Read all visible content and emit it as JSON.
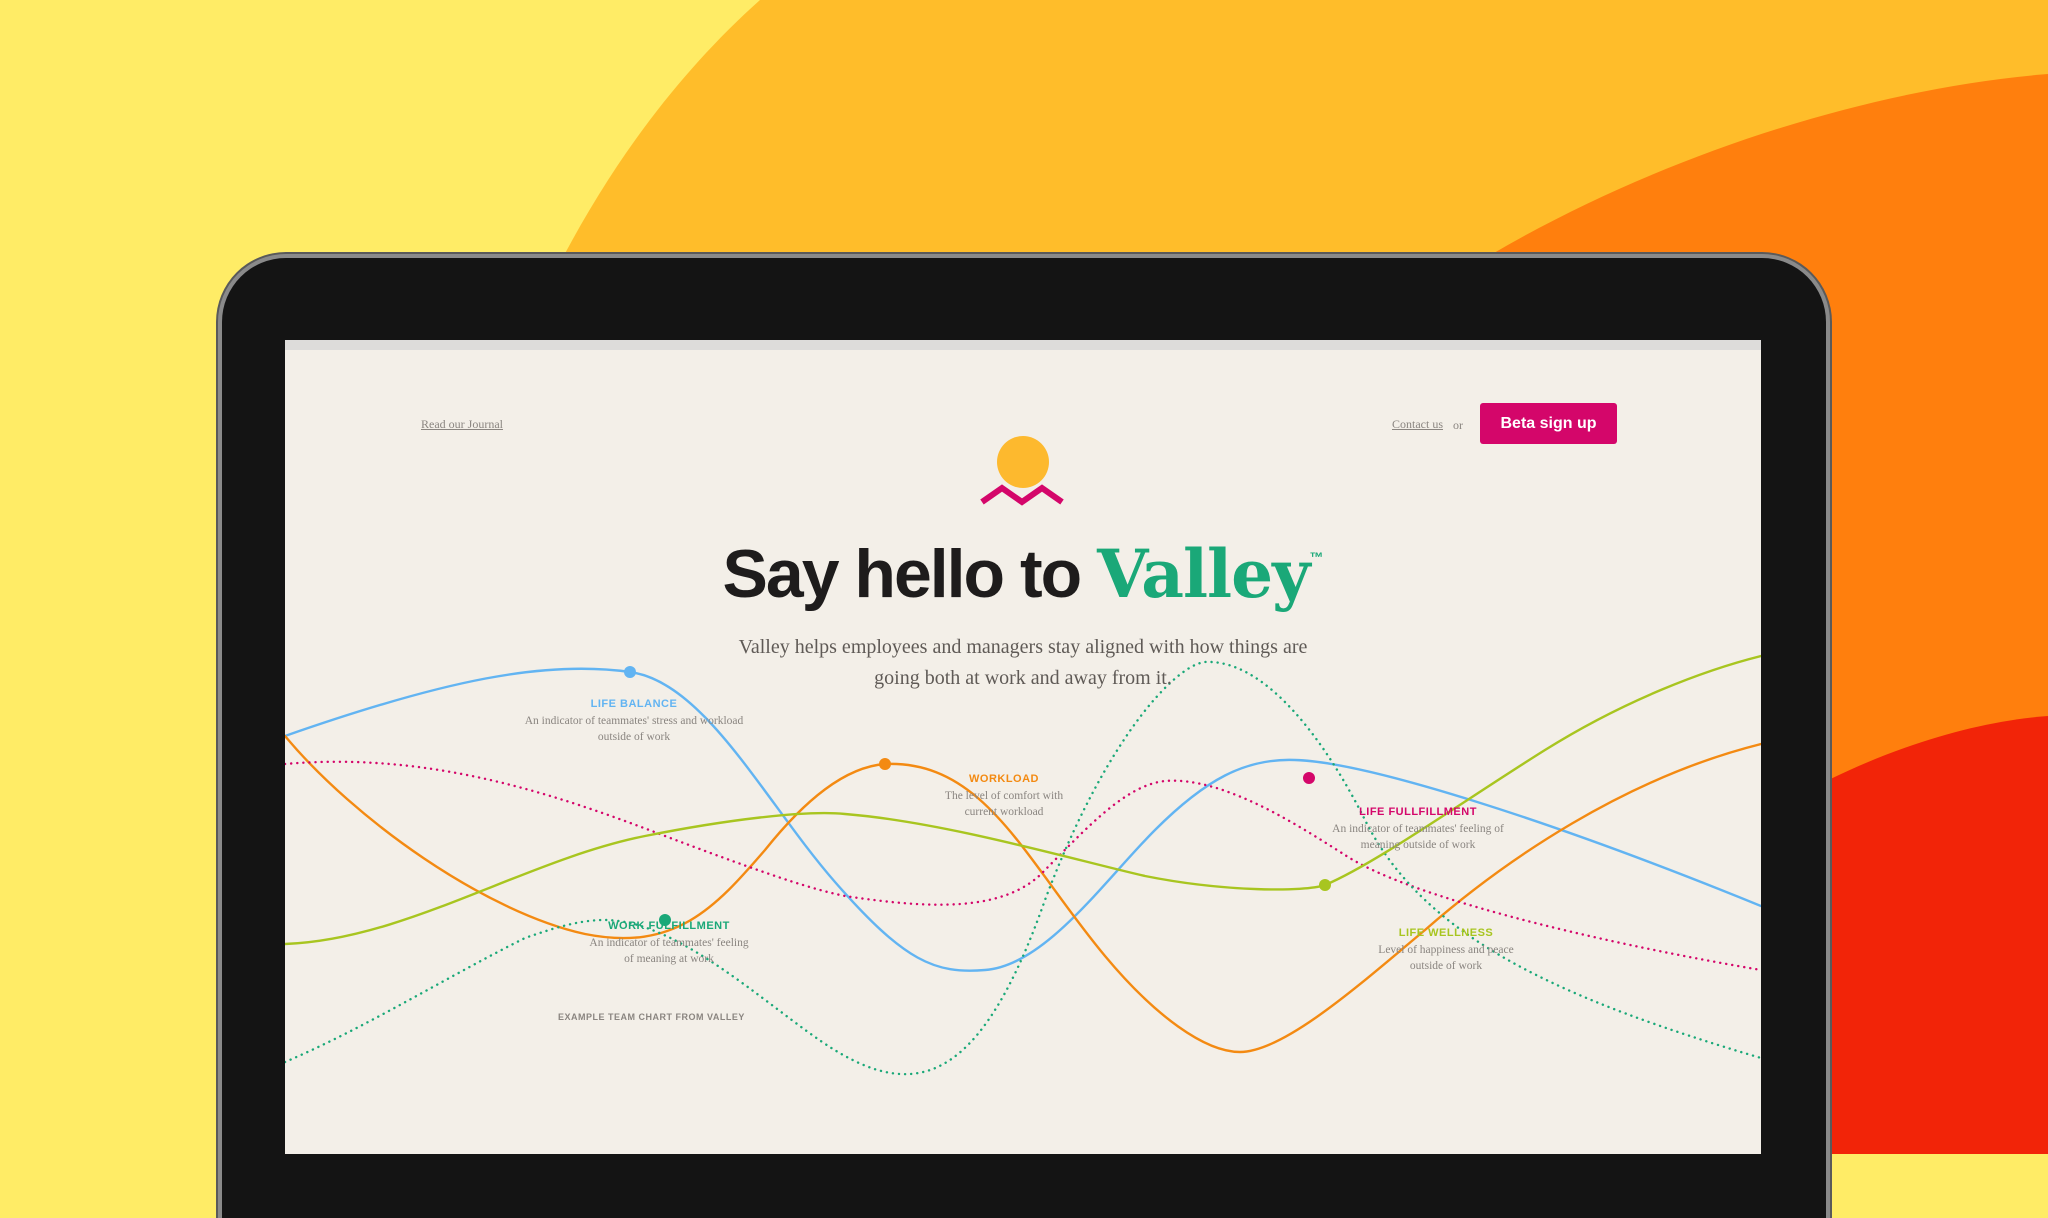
{
  "colors": {
    "background_yellow": "#ffec66",
    "background_gold": "#ffbd2a",
    "background_orange": "#ff7f0d",
    "background_red": "#f22408",
    "screen_bg": "#f3efe8",
    "brand_pink": "#d4066a",
    "brand_green": "#1aa878",
    "logo_sun": "#fdb92e"
  },
  "nav": {
    "journal_link": "Read our Journal",
    "contact_link": "Contact us",
    "or_text": "or",
    "beta_button": "Beta sign up"
  },
  "logo": {
    "icon": "valley-sun-mountains-icon"
  },
  "hero": {
    "headline_prefix": "Say hello to",
    "brand_name": "Valley",
    "trademark": "™",
    "subhead": "Valley helps employees and managers stay aligned with how things are going both at work and away from it."
  },
  "chart_data": {
    "type": "line",
    "title": "",
    "caption": "EXAMPLE TEAM CHART FROM VALLEY",
    "axes_visible": false,
    "grid": false,
    "series": [
      {
        "name": "LIFE BALANCE",
        "description": "An indicator of teammates' stress and workload outside of work",
        "color": "#62b4f2",
        "style": "solid",
        "highlight_point": 1
      },
      {
        "name": "WORKLOAD",
        "description": "The level of comfort with current workload",
        "color": "#f38a12",
        "style": "solid",
        "highlight_point": 2
      },
      {
        "name": "LIFE FULLFILLMENT",
        "description": "An indicator of teammates' feeling of meaning outside of work",
        "color": "#d4066a",
        "style": "dotted",
        "highlight_point": 3
      },
      {
        "name": "WORK FULFILLMENT",
        "description": "An indicator of teammates' feeling of meaning at work",
        "color": "#1aa878",
        "style": "dotted",
        "highlight_point": 1
      },
      {
        "name": "LIFE WELLNESS",
        "description": "Level of happiness and peace outside of work",
        "color": "#a8c520",
        "style": "solid",
        "highlight_point": 3
      }
    ]
  }
}
